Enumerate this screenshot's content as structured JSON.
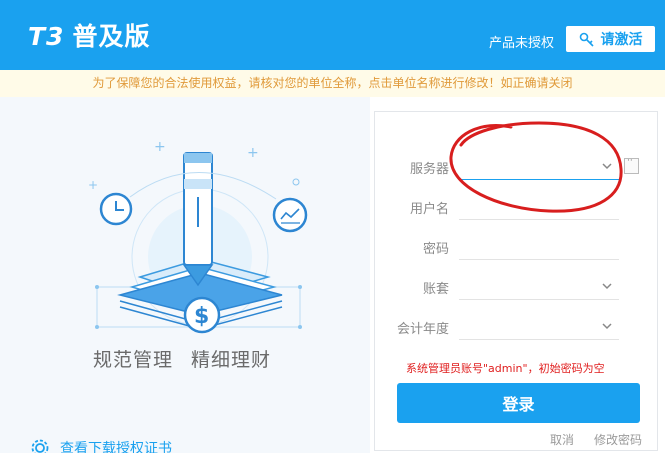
{
  "header": {
    "logo_prefix": "T3",
    "logo_text": "普及版",
    "unauthorized": "产品未授权",
    "activate_label": "请激活",
    "bg_color": "#1aa1ef"
  },
  "notice": "为了保障您的合法使用权益，请核对您的单位全称，点击单位名称进行修改！如正确请关闭",
  "left": {
    "slogan_1": "规范管理",
    "slogan_2": "精细理财",
    "help_link": "查看下载授权证书"
  },
  "form": {
    "server_label": "服务器",
    "server_value": "",
    "username_label": "用户名",
    "username_value": "",
    "password_label": "密码",
    "password_value": "",
    "account_label": "账套",
    "account_value": "",
    "year_label": "会计年度",
    "year_value": "",
    "tip": "系统管理员账号\"admin\"，初始密码为空",
    "login_label": "登录",
    "cancel_label": "取消",
    "change_password_label": "修改密码"
  },
  "colors": {
    "accent": "#1aa1ef",
    "warning_text": "#e02020",
    "notice_text": "#e09a3a",
    "annotation": "#d81e1e"
  }
}
